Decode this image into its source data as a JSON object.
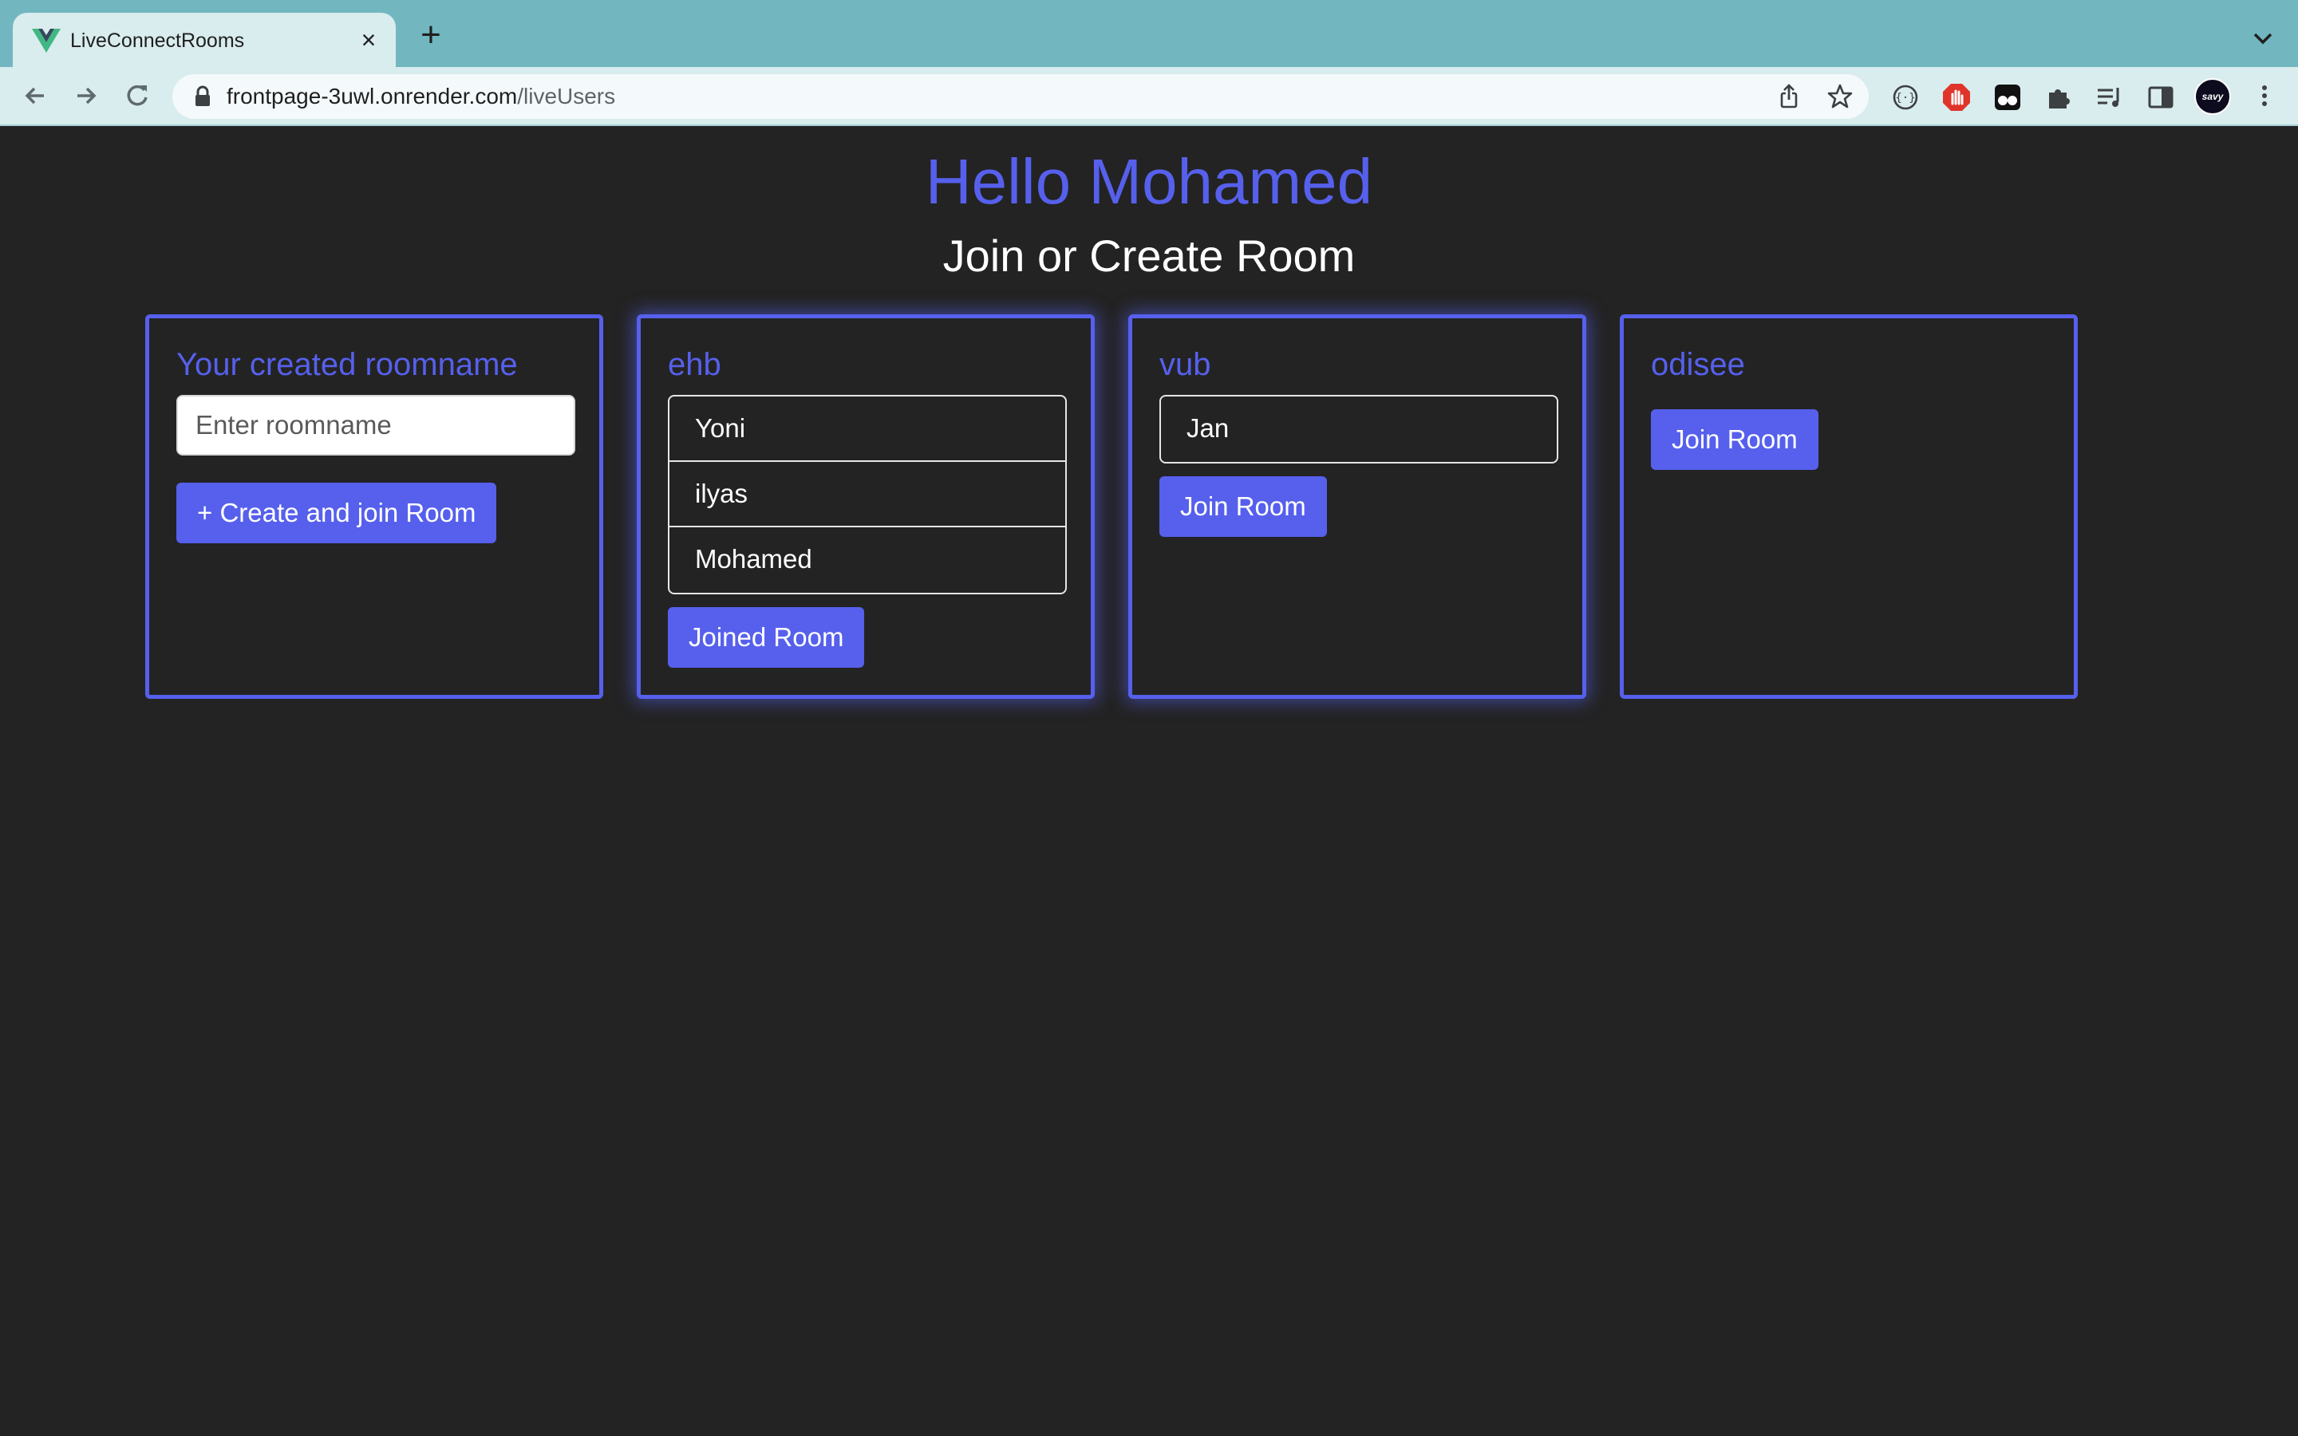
{
  "browser": {
    "tab_title": "LiveConnectRooms",
    "new_tab_label": "+",
    "close_label": "×",
    "url_host": "frontpage-3uwl.onrender.com",
    "url_path": "/liveUsers",
    "profile_label": "savy",
    "icons": {
      "favicon": "vue-logo-icon",
      "back": "back-arrow-icon",
      "forward": "forward-arrow-icon",
      "reload": "reload-icon",
      "lock": "lock-icon",
      "share": "share-icon",
      "bookmark": "star-icon",
      "extensions": [
        "code-brackets-icon",
        "adblock-icon",
        "glasses-icon",
        "puzzle-icon",
        "media-queue-icon",
        "side-panel-icon"
      ],
      "menu": "kebab-menu-icon"
    }
  },
  "page": {
    "greeting": "Hello Mohamed",
    "subtitle": "Join or Create Room"
  },
  "create_card": {
    "title": "Your created roomname",
    "input_placeholder": "Enter roomname",
    "input_value": "",
    "button_label": "+ Create and join Room"
  },
  "rooms": [
    {
      "name": "ehb",
      "users": [
        "Yoni",
        "ilyas",
        "Mohamed"
      ],
      "button_label": "Joined Room",
      "joined": true
    },
    {
      "name": "vub",
      "users": [
        "Jan"
      ],
      "button_label": "Join Room",
      "joined": false
    },
    {
      "name": "odisee",
      "users": [],
      "button_label": "Join Room",
      "joined": false
    }
  ],
  "colors": {
    "accent": "#5660ec",
    "background": "#232323",
    "tabbar": "#72b7bf",
    "toolbar": "#d9ecee"
  }
}
